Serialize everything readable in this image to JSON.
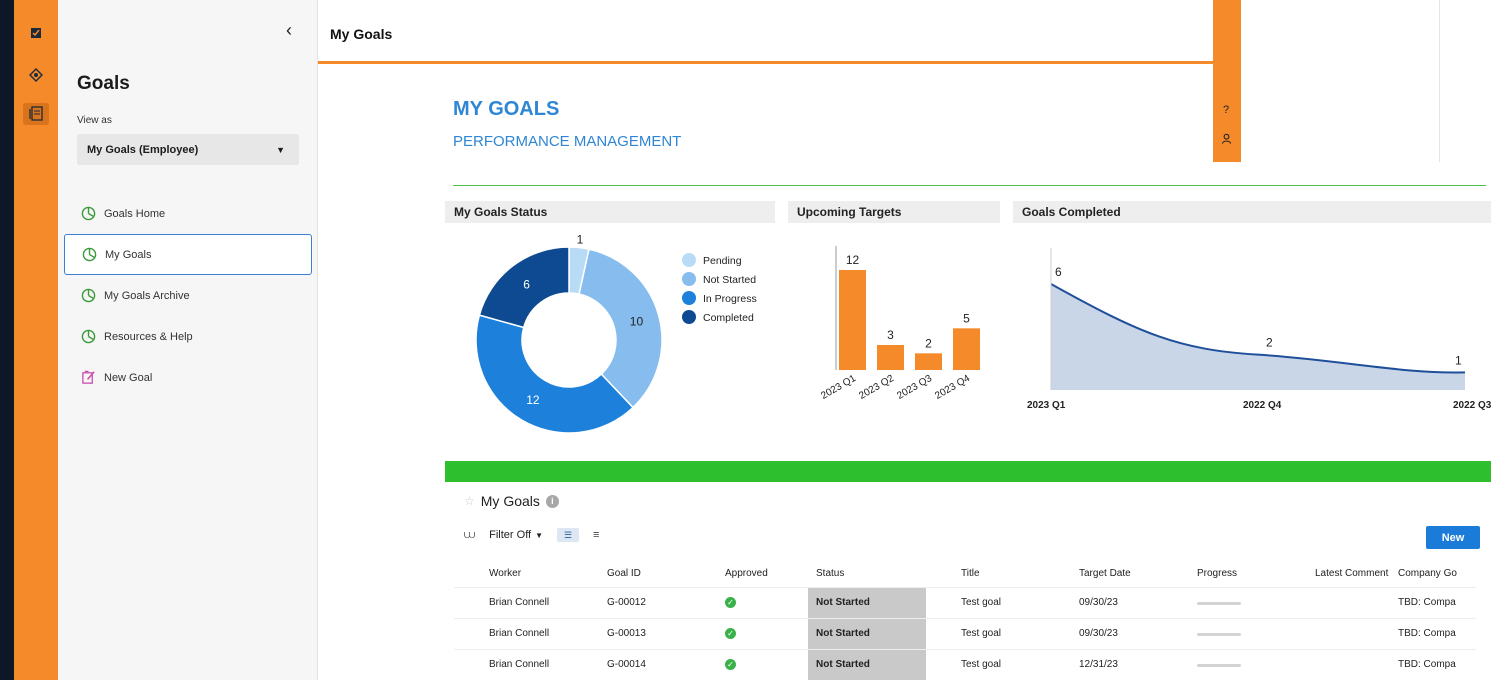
{
  "rail": {
    "icons": [
      "app-logo-icon",
      "goals-app-icon",
      "worksheet-icon"
    ]
  },
  "sidebar": {
    "title": "Goals",
    "view_as_label": "View as",
    "view_as_value": "My Goals (Employee)",
    "items": [
      {
        "label": "Goals Home",
        "icon": "pie-chart-icon",
        "active": false
      },
      {
        "label": "My Goals",
        "icon": "pie-chart-icon",
        "active": true
      },
      {
        "label": "My Goals Archive",
        "icon": "pie-chart-icon",
        "active": false
      },
      {
        "label": "Resources & Help",
        "icon": "pie-chart-icon",
        "active": false
      },
      {
        "label": "New Goal",
        "icon": "new-goal-icon",
        "active": false
      }
    ]
  },
  "header": {
    "title": "My Goals"
  },
  "popup": {
    "help": "?",
    "user": "user-icon"
  },
  "hero": {
    "title": "MY GOALS",
    "subtitle": "PERFORMANCE MANAGEMENT"
  },
  "panels": {
    "status": "My Goals Status",
    "targets": "Upcoming Targets",
    "completed": "Goals Completed"
  },
  "chart_data": [
    {
      "type": "pie",
      "title": "My Goals Status",
      "categories": [
        "Pending",
        "Not Started",
        "In Progress",
        "Completed"
      ],
      "values": [
        1,
        10,
        12,
        6
      ],
      "colors": [
        "#b9dcf6",
        "#86bdee",
        "#1d80db",
        "#0d4a91"
      ],
      "legend": "right"
    },
    {
      "type": "bar",
      "title": "Upcoming Targets",
      "categories": [
        "2023 Q1",
        "2023 Q2",
        "2023 Q3",
        "2023 Q4"
      ],
      "values": [
        12,
        3,
        2,
        5
      ],
      "color": "#f58a2a"
    },
    {
      "type": "area",
      "title": "Goals Completed",
      "categories": [
        "2023 Q1",
        "2022 Q4",
        "2022 Q3"
      ],
      "values": [
        6,
        2,
        1
      ],
      "color": "#1f4f9b",
      "fill": "#c9d6e8"
    }
  ],
  "grid": {
    "title": "My Goals",
    "filter_label": "Filter Off",
    "new_label": "New",
    "columns": [
      "Worker",
      "Goal ID",
      "Approved",
      "Status",
      "Title",
      "Target Date",
      "Progress",
      "Latest Comment",
      "Company Go"
    ],
    "rows": [
      {
        "worker": "Brian Connell",
        "goal_id": "G-00012",
        "approved": true,
        "status": "Not Started",
        "title": "Test goal",
        "target_date": "09/30/23",
        "progress": 0,
        "comment": "",
        "company": "TBD: Compa"
      },
      {
        "worker": "Brian Connell",
        "goal_id": "G-00013",
        "approved": true,
        "status": "Not Started",
        "title": "Test goal",
        "target_date": "09/30/23",
        "progress": 0,
        "comment": "",
        "company": "TBD: Compa"
      },
      {
        "worker": "Brian Connell",
        "goal_id": "G-00014",
        "approved": true,
        "status": "Not Started",
        "title": "Test goal",
        "target_date": "12/31/23",
        "progress": 0,
        "comment": "",
        "company": "TBD: Compa"
      }
    ]
  },
  "colors": {
    "accent": "#f58a2a",
    "brand_blue": "#2f86d4",
    "green": "#2dbf2d"
  }
}
